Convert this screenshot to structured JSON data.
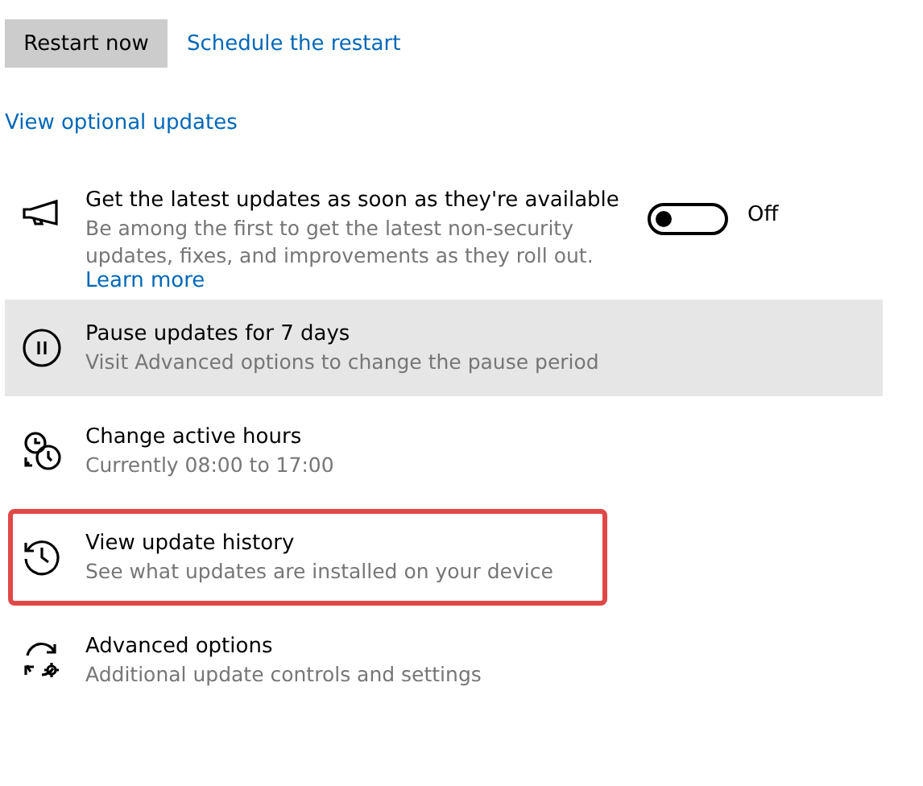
{
  "actions": {
    "restart_button": "Restart now",
    "schedule_link": "Schedule the restart"
  },
  "optional_updates_link": "View optional updates",
  "latest_updates": {
    "title": "Get the latest updates as soon as they're available",
    "description": "Be among the first to get the latest non-security updates, fixes, and improvements as they roll out.",
    "learn_more": "Learn more",
    "on": false,
    "state_label": "Off"
  },
  "options": [
    {
      "kind": "pause",
      "title": "Pause updates for 7 days",
      "subtitle": "Visit Advanced options to change the pause period",
      "hovered": true,
      "highlighted": false
    },
    {
      "kind": "hours",
      "title": "Change active hours",
      "subtitle": "Currently 08:00 to 17:00",
      "hovered": false,
      "highlighted": false
    },
    {
      "kind": "history",
      "title": "View update history",
      "subtitle": "See what updates are installed on your device",
      "hovered": false,
      "highlighted": true
    },
    {
      "kind": "advanced",
      "title": "Advanced options",
      "subtitle": "Additional update controls and settings",
      "hovered": false,
      "highlighted": false
    }
  ]
}
